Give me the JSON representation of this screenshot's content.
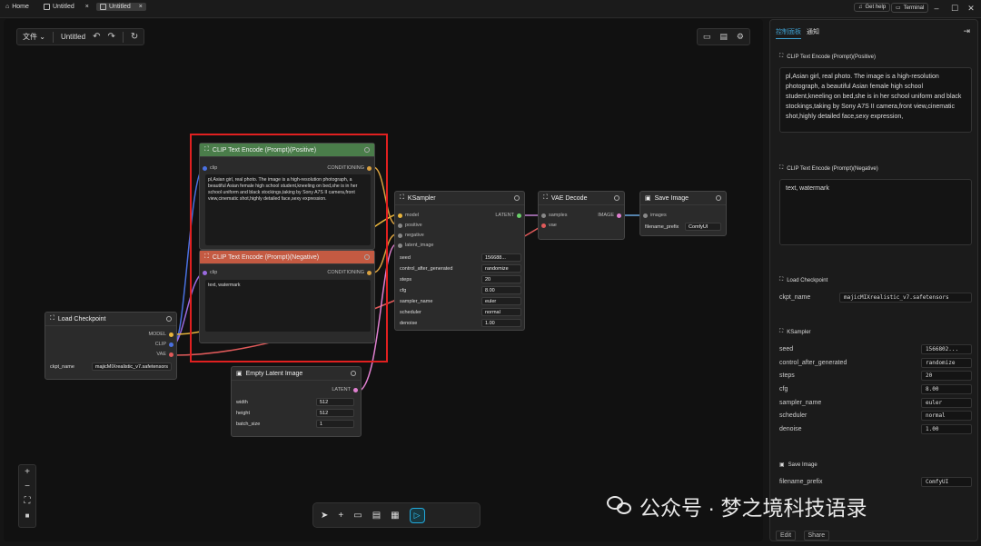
{
  "titlebar": {
    "home": "Home",
    "tabs": [
      "Untitled",
      "Untitled"
    ],
    "help": "Get help",
    "terminal": "Terminal"
  },
  "menu": {
    "file": "文件",
    "title": "Untitled"
  },
  "colors": {
    "positive_header": "#4a7d4a",
    "negative_header": "#c45a42",
    "highlight": "#e02020",
    "accent": "#3fa0d0",
    "model": "#e8b43c",
    "clip": "#e8d84a",
    "vae": "#e05a5a",
    "conditioning": "#d8a040",
    "latent": "#e080d0",
    "image": "#6aa8e0",
    "link_blue": "#4a70e0"
  },
  "nodes": {
    "positive": {
      "title": "CLIP Text Encode (Prompt)(Positive)",
      "input": "clip",
      "output": "CONDITIONING",
      "text": "pl,Asian girl, real photo. The image is a high-resolution photograph, a beautiful Asian female high school student,kneeling on bed,she is in her school uniform and black stockings,taking by Sony A7S II camera,front view,cinematic shot,highly detailed face,sexy expression."
    },
    "negative": {
      "title": "CLIP Text Encode (Prompt)(Negative)",
      "input": "clip",
      "output": "CONDITIONING",
      "text": "text, watermark"
    },
    "checkpoint": {
      "title": "Load Checkpoint",
      "outputs": [
        "MODEL",
        "CLIP",
        "VAE"
      ],
      "widget_label": "ckpt_name",
      "widget_value": "majicMIXrealistic_v7.safetensors"
    },
    "latent": {
      "title": "Empty Latent Image",
      "output": "LATENT",
      "widgets": [
        {
          "label": "width",
          "value": "512"
        },
        {
          "label": "height",
          "value": "512"
        },
        {
          "label": "batch_size",
          "value": "1"
        }
      ]
    },
    "ksampler": {
      "title": "KSampler",
      "inputs": [
        "model",
        "positive",
        "negative",
        "latent_image"
      ],
      "output": "LATENT",
      "widgets": [
        {
          "label": "seed",
          "value": "156688..."
        },
        {
          "label": "control_after_generated",
          "value": "randomize"
        },
        {
          "label": "steps",
          "value": "20"
        },
        {
          "label": "cfg",
          "value": "8.00"
        },
        {
          "label": "sampler_name",
          "value": "euler"
        },
        {
          "label": "scheduler",
          "value": "normal"
        },
        {
          "label": "denoise",
          "value": "1.00"
        }
      ]
    },
    "vae": {
      "title": "VAE Decode",
      "inputs": [
        "samples",
        "vae"
      ],
      "output": "IMAGE"
    },
    "save": {
      "title": "Save Image",
      "input": "images",
      "widget_label": "filename_prefix",
      "widget_value": "ComfyUI"
    }
  },
  "sidebar": {
    "tabs": [
      "控制面板",
      "通知"
    ],
    "positive_title": "CLIP Text Encode (Prompt)(Positive)",
    "positive_text": "pl,Asian girl, real photo. The image is a high-resolution photograph, a beautiful Asian female high school student,kneeling on bed,she is in her school uniform and black stockings,taking by Sony A7S II camera,front view,cinematic shot,highly detailed face,sexy expression,",
    "negative_title": "CLIP Text Encode (Prompt)(Negative)",
    "negative_text": "text, watermark",
    "checkpoint_title": "Load Checkpoint",
    "ckpt_label": "ckpt_name",
    "ckpt_value": "majicMIXrealistic_v7.safetensors",
    "ksampler_title": "KSampler",
    "ksampler_rows": [
      {
        "label": "seed",
        "value": "1566802..."
      },
      {
        "label": "control_after_generated",
        "value": "randomize"
      },
      {
        "label": "steps",
        "value": "20"
      },
      {
        "label": "cfg",
        "value": "8.00"
      },
      {
        "label": "sampler_name",
        "value": "euler"
      },
      {
        "label": "scheduler",
        "value": "normal"
      },
      {
        "label": "denoise",
        "value": "1.00"
      }
    ],
    "save_title": "Save Image",
    "save_label": "filename_prefix",
    "save_value": "ComfyUI",
    "edit": "Edit",
    "share": "Share"
  },
  "watermark": "公众号 · 梦之境科技语录"
}
